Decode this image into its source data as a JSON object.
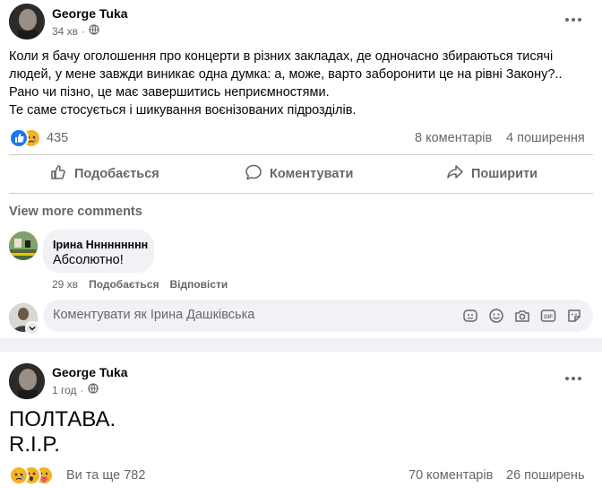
{
  "post1": {
    "author": "George Tuka",
    "time": "34 хв",
    "text_lines": [
      "Коли я бачу оголошення про концерти в різних закладах, де одночасно збираються тисячі",
      "людей, у мене завжди виникає одна думка: а, може, варто заборонити це на рівні Закону?..",
      "Рано чи пізно, це має завершитись неприємностями.",
      "Те саме стосується і шикування воєнізованих підрозділів."
    ],
    "reaction_count": "435",
    "comments_count": "8 коментарів",
    "shares_count": "4 поширення",
    "actions": {
      "like": "Подобається",
      "comment": "Коментувати",
      "share": "Поширити"
    },
    "view_more": "View more comments",
    "comment": {
      "author": "Ірина Ннннннннн",
      "text": "Абсолютно!",
      "time": "29 хв",
      "like": "Подобається",
      "reply": "Відповісти"
    },
    "comment_input_placeholder": "Коментувати як Ірина Дашківська"
  },
  "post2": {
    "author": "George Tuka",
    "time": "1 год",
    "text_lines": [
      "ПОЛТАВА.",
      "R.I.P."
    ],
    "reaction_text": "Ви та ще 782",
    "comments_count": "70 коментарів",
    "shares_count": "26 поширень"
  },
  "colors": {
    "like_blue": "#1877f2",
    "sad_yellow": "#f7b125",
    "secondary_text": "#65676b",
    "input_bg": "#f0f2f5"
  }
}
